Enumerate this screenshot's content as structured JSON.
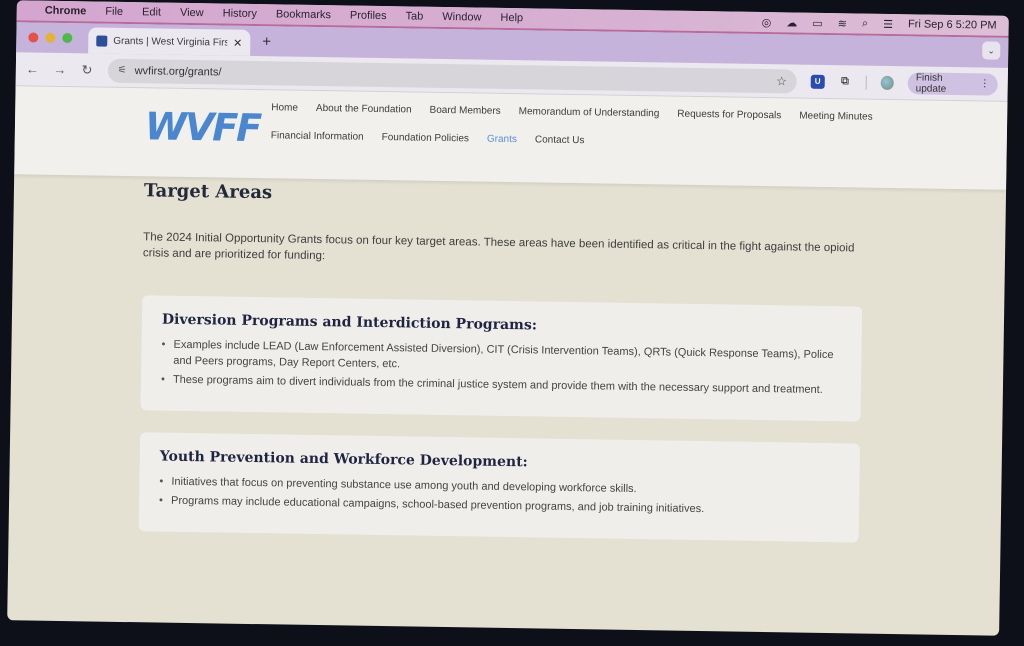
{
  "menubar": {
    "app": "Chrome",
    "items": [
      "File",
      "Edit",
      "View",
      "History",
      "Bookmarks",
      "Profiles",
      "Tab",
      "Window",
      "Help"
    ],
    "status_icons": [
      "creative-cloud-icon",
      "cloud-icon",
      "battery-charging-icon",
      "wifi-icon",
      "spotlight-search-icon",
      "control-center-icon"
    ],
    "clock": "Fri Sep 6  5:20 PM"
  },
  "browser": {
    "tab_title": "Grants | West Virginia First Fo",
    "new_tab_label": "+",
    "close_label": "✕",
    "url": "wvfirst.org/grants/",
    "finish_update_label": "Finish update"
  },
  "site": {
    "logo_text": "WVFF",
    "nav_row1": [
      {
        "label": "Home",
        "active": false
      },
      {
        "label": "About the Foundation",
        "active": false
      },
      {
        "label": "Board Members",
        "active": false
      },
      {
        "label": "Memorandum of Understanding",
        "active": false
      },
      {
        "label": "Requests for Proposals",
        "active": false
      },
      {
        "label": "Meeting Minutes",
        "active": false
      }
    ],
    "nav_row2": [
      {
        "label": "Financial Information",
        "active": false
      },
      {
        "label": "Foundation Policies",
        "active": false
      },
      {
        "label": "Grants",
        "active": true
      },
      {
        "label": "Contact Us",
        "active": false
      }
    ],
    "accent_color": "#5b8fd4"
  },
  "content": {
    "title": "Target Areas",
    "intro": "The 2024 Initial Opportunity Grants focus on four key target areas. These areas have been identified as critical in the fight against the opioid crisis and are prioritized for funding:",
    "cards": [
      {
        "title": "Diversion Programs and Interdiction Programs:",
        "bullets": [
          "Examples include LEAD (Law Enforcement Assisted Diversion), CIT (Crisis Intervention Teams), QRTs (Quick Response Teams), Police and Peers programs, Day Report Centers, etc.",
          "These programs aim to divert individuals from the criminal justice system and provide them with the necessary support and treatment."
        ]
      },
      {
        "title": "Youth Prevention and Workforce Development:",
        "bullets": [
          "Initiatives that focus on preventing substance use among youth and developing workforce skills.",
          "Programs may include educational campaigns, school-based prevention programs, and job training initiatives."
        ]
      }
    ]
  }
}
